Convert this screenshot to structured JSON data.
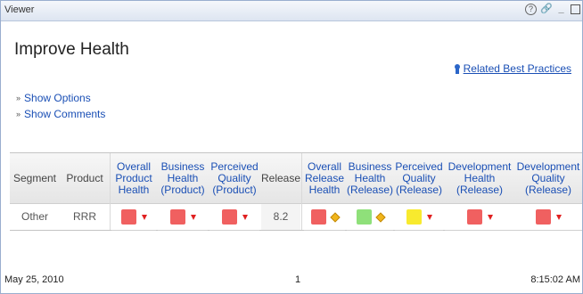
{
  "window": {
    "title": "Viewer",
    "help_glyph": "?",
    "link_glyph": "✂",
    "min_glyph": "_",
    "max_glyph": ""
  },
  "page": {
    "title": "Improve Health",
    "related_link": "Related Best Practices"
  },
  "options": [
    {
      "label": "Show Options"
    },
    {
      "label": "Show Comments"
    }
  ],
  "table": {
    "headers": [
      [
        "Segment"
      ],
      [
        "Product"
      ],
      [
        "Overall",
        "Product",
        "Health"
      ],
      [
        "Business",
        "Health",
        "(Product)"
      ],
      [
        "Perceived",
        "Quality",
        "(Product)"
      ],
      [
        "Release"
      ],
      [
        "Overall",
        "Release",
        "Health"
      ],
      [
        "Business",
        "Health",
        "(Release)"
      ],
      [
        "Perceived",
        "Quality",
        "(Release)"
      ],
      [
        "Development",
        "Health",
        "(Release)"
      ],
      [
        "Development",
        "Quality",
        "(Release)"
      ]
    ],
    "row": {
      "segment": "Other",
      "product": "RRR",
      "release": "8.2",
      "indicators": [
        {
          "status": "red",
          "color": "#f06060",
          "trend": "down-arrow"
        },
        {
          "status": "red",
          "color": "#f06060",
          "trend": "down-arrow"
        },
        {
          "status": "red",
          "color": "#f06060",
          "trend": "down-arrow"
        },
        {
          "status": "red",
          "color": "#f06060",
          "trend": "diamond"
        },
        {
          "status": "green",
          "color": "#8fe07a",
          "trend": "diamond"
        },
        {
          "status": "yellow",
          "color": "#f8ea2e",
          "trend": "down-arrow"
        },
        {
          "status": "red",
          "color": "#f06060",
          "trend": "down-arrow"
        },
        {
          "status": "red",
          "color": "#f06060",
          "trend": "down-arrow"
        }
      ]
    }
  },
  "footer": {
    "date": "May 25, 2010",
    "page": "1",
    "time": "8:15:02 AM"
  }
}
